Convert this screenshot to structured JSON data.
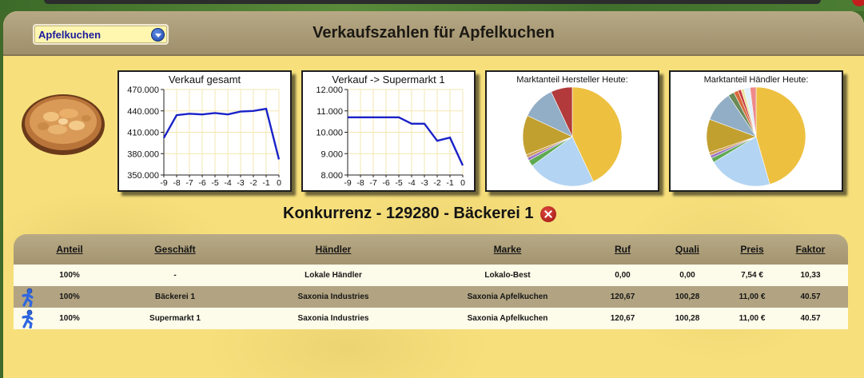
{
  "header": {
    "title": "Verkaufszahlen für Apfelkuchen",
    "product_select": "Apfelkuchen"
  },
  "charts": {
    "total": {
      "title": "Verkauf gesamt",
      "yticks": [
        "470.000",
        "440.000",
        "410.000",
        "380.000",
        "350.000"
      ],
      "xticks": [
        "-9",
        "-8",
        "-7",
        "-6",
        "-5",
        "-4",
        "-3",
        "-2",
        "-1",
        "0"
      ]
    },
    "supermarket": {
      "title": "Verkauf -> Supermarkt 1",
      "yticks": [
        "12.000",
        "11.000",
        "10.000",
        "9.000",
        "8.000"
      ],
      "xticks": [
        "-9",
        "-8",
        "-7",
        "-6",
        "-5",
        "-4",
        "-3",
        "-2",
        "-1",
        "0"
      ]
    },
    "pie_manufacturer": {
      "title": "Marktanteil Hersteller Heute:"
    },
    "pie_dealer": {
      "title": "Marktanteil Händler Heute:"
    }
  },
  "chart_data": [
    {
      "type": "line",
      "title": "Verkauf gesamt",
      "x": [
        -9,
        -8,
        -7,
        -6,
        -5,
        -4,
        -3,
        -2,
        -1,
        0
      ],
      "values": [
        402000,
        434000,
        436000,
        435000,
        437000,
        435000,
        439000,
        440000,
        443000,
        372000
      ],
      "ylim": [
        350000,
        470000
      ],
      "grid": true,
      "color": "#1a22c8"
    },
    {
      "type": "line",
      "title": "Verkauf -> Supermarkt 1",
      "x": [
        -9,
        -8,
        -7,
        -6,
        -5,
        -4,
        -3,
        -2,
        -1,
        0
      ],
      "values": [
        10700,
        10700,
        10700,
        10700,
        10700,
        10400,
        10400,
        9600,
        9750,
        8450
      ],
      "ylim": [
        8000,
        12000
      ],
      "grid": true,
      "color": "#1a22c8"
    },
    {
      "type": "pie",
      "title": "Marktanteil Hersteller Heute:",
      "values": [
        43,
        22,
        2,
        1,
        1,
        13,
        11,
        7
      ],
      "colors": [
        "#edc040",
        "#b3d4f2",
        "#5daa52",
        "#9d78c8",
        "#cfa050",
        "#c2a030",
        "#92aec6",
        "#b23a3a"
      ]
    },
    {
      "type": "pie",
      "title": "Marktanteil Händler Heute:",
      "values": [
        46,
        21,
        1.5,
        1,
        1,
        11,
        10,
        2,
        1.5,
        1,
        1,
        2,
        2
      ],
      "colors": [
        "#edc040",
        "#b3d4f2",
        "#5daa52",
        "#9d78c8",
        "#cfa050",
        "#c2a030",
        "#92aec6",
        "#6a8a58",
        "#d86a3a",
        "#c83a3a",
        "#e8e2a0",
        "#e0f0fa",
        "#ee8a8a"
      ]
    }
  ],
  "competitor": {
    "title": "Konkurrenz - 129280 - Bäckerei 1"
  },
  "table": {
    "columns": [
      "Anteil",
      "Geschäft",
      "Händler",
      "Marke",
      "Ruf",
      "Quali",
      "Preis",
      "Faktor"
    ],
    "rows": [
      {
        "icon": "",
        "cells": [
          "100%",
          "-",
          "Lokale Händler",
          "Lokalo-Best",
          "0,00",
          "0,00",
          "7,54 €",
          "10,33"
        ]
      },
      {
        "icon": "runner-icon",
        "cells": [
          "100%",
          "Bäckerei 1",
          "Saxonia Industries",
          "Saxonia Apfelkuchen",
          "120,67",
          "100,28",
          "11,00 €",
          "40.57"
        ]
      },
      {
        "icon": "runner-icon",
        "cells": [
          "100%",
          "Supermarkt 1",
          "Saxonia Industries",
          "Saxonia Apfelkuchen",
          "120,67",
          "100,28",
          "11,00 €",
          "40.57"
        ]
      }
    ]
  }
}
